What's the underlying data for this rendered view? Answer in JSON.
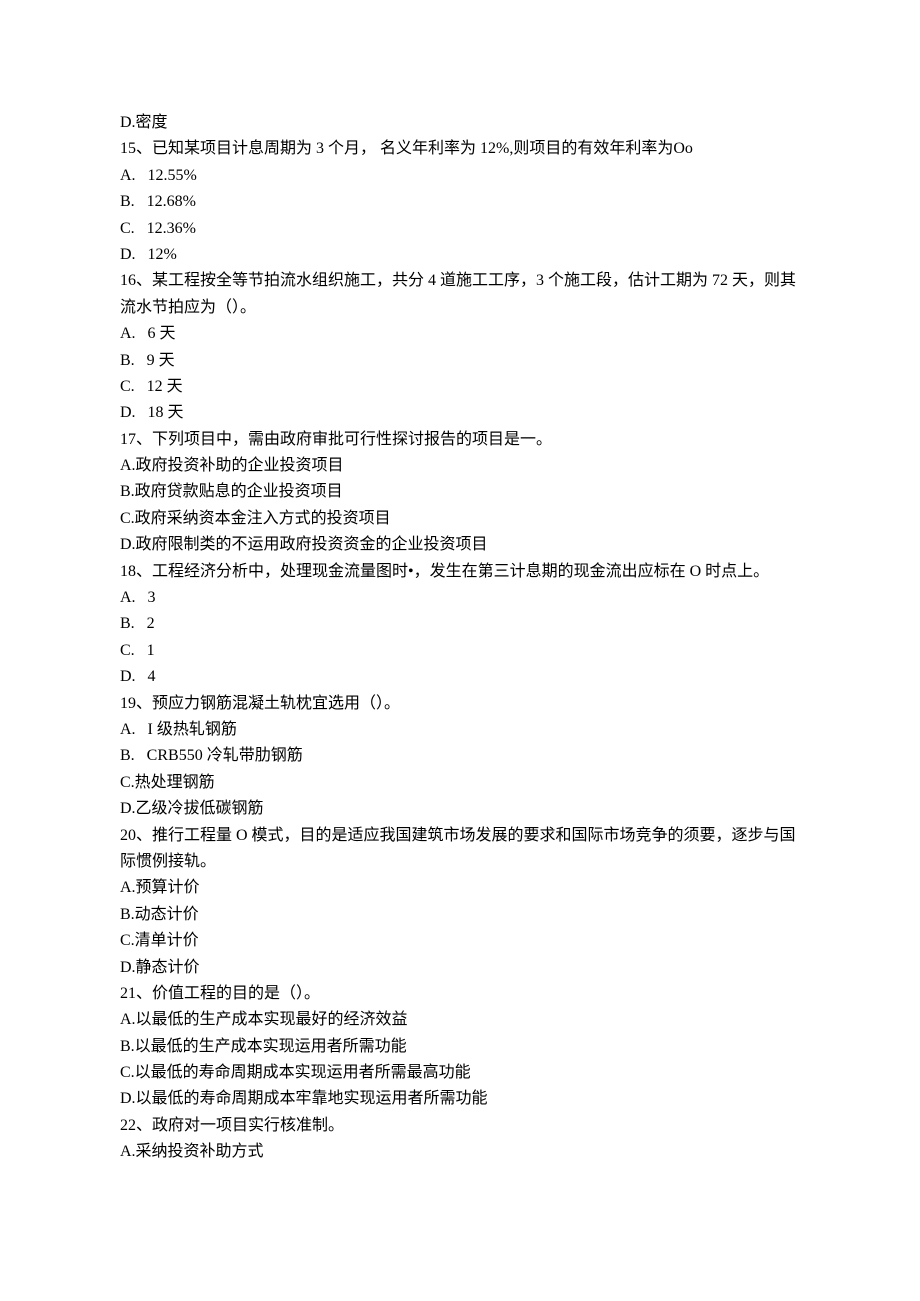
{
  "lines": [
    "D.密度",
    "15、已知某项目计息周期为 3 个月， 名义年利率为 12%,则项目的有效年利率为Oo",
    "A.   12.55%",
    "B.   12.68%",
    "C.   12.36%",
    "D.   12%",
    "16、某工程按全等节拍流水组织施工，共分 4 道施工工序，3 个施工段，估计工期为 72 天，则其流水节拍应为（）。",
    "A.   6 天",
    "B.   9 天",
    "C.   12 天",
    "D.   18 天",
    "17、下列项目中，需由政府审批可行性探讨报告的项目是一。",
    "A.政府投资补助的企业投资项目",
    "B.政府贷款贴息的企业投资项目",
    "C.政府采纳资本金注入方式的投资项目",
    "D.政府限制类的不运用政府投资资金的企业投资项目",
    "18、工程经济分析中，处理现金流量图时•，发生在第三计息期的现金流出应标在 O 时点上。",
    "A.   3",
    "B.   2",
    "C.   1",
    "D.   4",
    "19、预应力钢筋混凝土轨枕宜选用（）。",
    "A.   I 级热轧钢筋",
    "B.   CRB550 冷轧带肋钢筋",
    "C.热处理钢筋",
    "D.乙级冷拔低碳钢筋",
    "20、推行工程量 O 模式，目的是适应我国建筑市场发展的要求和国际市场竞争的须要，逐步与国际惯例接轨。",
    "A.预算计价",
    "B.动态计价",
    "C.清单计价",
    "D.静态计价",
    "21、价值工程的目的是（）。",
    "A.以最低的生产成本实现最好的经济效益",
    "B.以最低的生产成本实现运用者所需功能",
    "C.以最低的寿命周期成本实现运用者所需最高功能",
    "D.以最低的寿命周期成本牢靠地实现运用者所需功能",
    "22、政府对一项目实行核准制。",
    "A.采纳投资补助方式"
  ]
}
